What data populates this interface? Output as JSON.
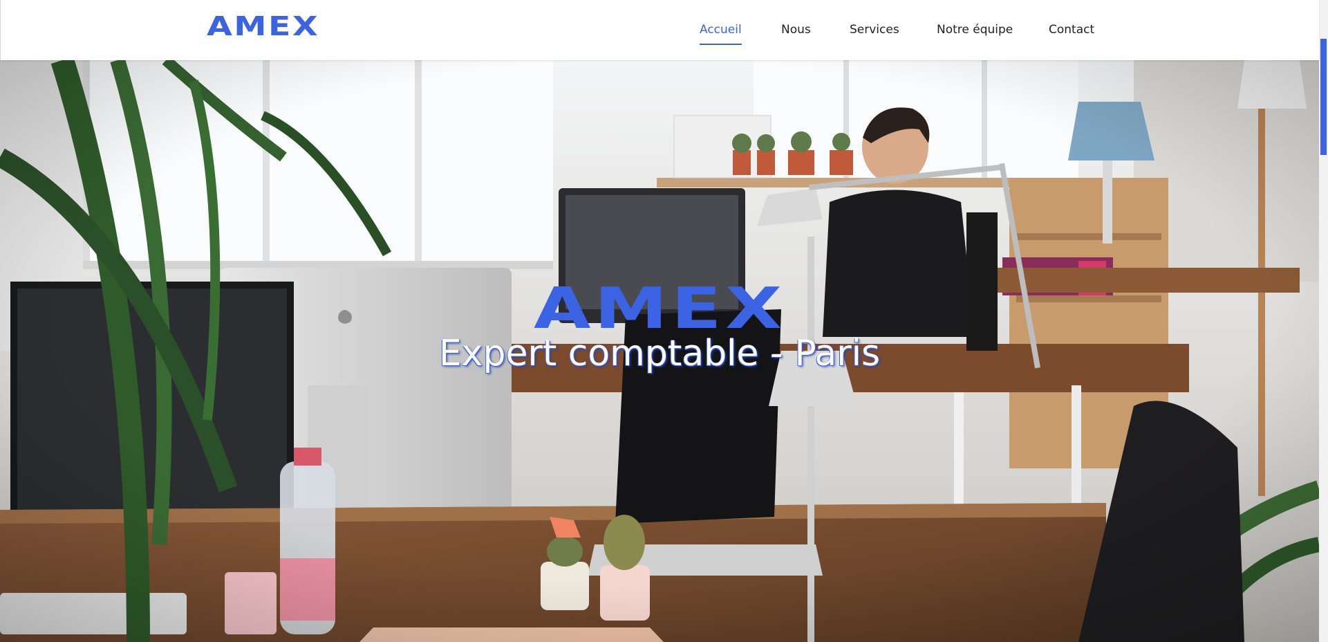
{
  "header": {
    "logo": "AMEX",
    "nav": [
      {
        "label": "Accueil",
        "active": true
      },
      {
        "label": "Nous",
        "active": false
      },
      {
        "label": "Services",
        "active": false
      },
      {
        "label": "Notre équipe",
        "active": false
      },
      {
        "label": "Contact",
        "active": false
      }
    ]
  },
  "hero": {
    "title": "AMEX",
    "subtitle": "Expert comptable - Paris",
    "image": "office-workspace-photo"
  },
  "colors": {
    "accent": "#3b63e3",
    "text": "#222222",
    "background": "#ffffff"
  }
}
